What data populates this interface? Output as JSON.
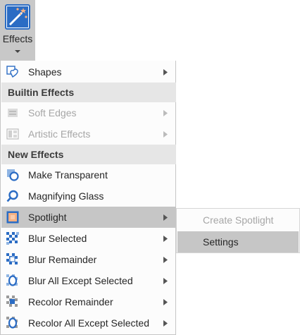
{
  "ribbon": {
    "label": "Effects",
    "icon": "magic-wand-icon"
  },
  "menu": {
    "items": [
      {
        "label": "Shapes",
        "icon": "shapes-icon",
        "submenu": true,
        "disabled": false
      },
      {
        "header": "Builtin Effects"
      },
      {
        "label": "Soft Edges",
        "icon": "soft-edges-icon",
        "submenu": true,
        "disabled": true
      },
      {
        "label": "Artistic Effects",
        "icon": "artistic-effects-icon",
        "submenu": true,
        "disabled": true
      },
      {
        "header": "New Effects"
      },
      {
        "label": "Make Transparent",
        "icon": "make-transparent-icon",
        "submenu": false,
        "disabled": false
      },
      {
        "label": "Magnifying Glass",
        "icon": "magnifying-glass-icon",
        "submenu": false,
        "disabled": false
      },
      {
        "label": "Spotlight",
        "icon": "spotlight-icon",
        "submenu": true,
        "disabled": false,
        "highlighted": true
      },
      {
        "label": "Blur Selected",
        "icon": "blur-selected-icon",
        "submenu": true,
        "disabled": false
      },
      {
        "label": "Blur Remainder",
        "icon": "blur-remainder-icon",
        "submenu": true,
        "disabled": false
      },
      {
        "label": "Blur All Except Selected",
        "icon": "blur-all-except-icon",
        "submenu": true,
        "disabled": false
      },
      {
        "label": "Recolor Remainder",
        "icon": "recolor-remainder-icon",
        "submenu": true,
        "disabled": false
      },
      {
        "label": "Recolor All Except Selected",
        "icon": "recolor-all-except-icon",
        "submenu": true,
        "disabled": false
      }
    ]
  },
  "submenu": {
    "items": [
      {
        "label": "Create Spotlight",
        "disabled": true
      },
      {
        "label": "Settings",
        "disabled": false,
        "highlighted": true
      }
    ]
  },
  "colors": {
    "accent_blue": "#2b6cc4",
    "highlight": "#c6c6c6",
    "header_bg": "#e6e6e6",
    "disabled_text": "#a6a6a6"
  }
}
